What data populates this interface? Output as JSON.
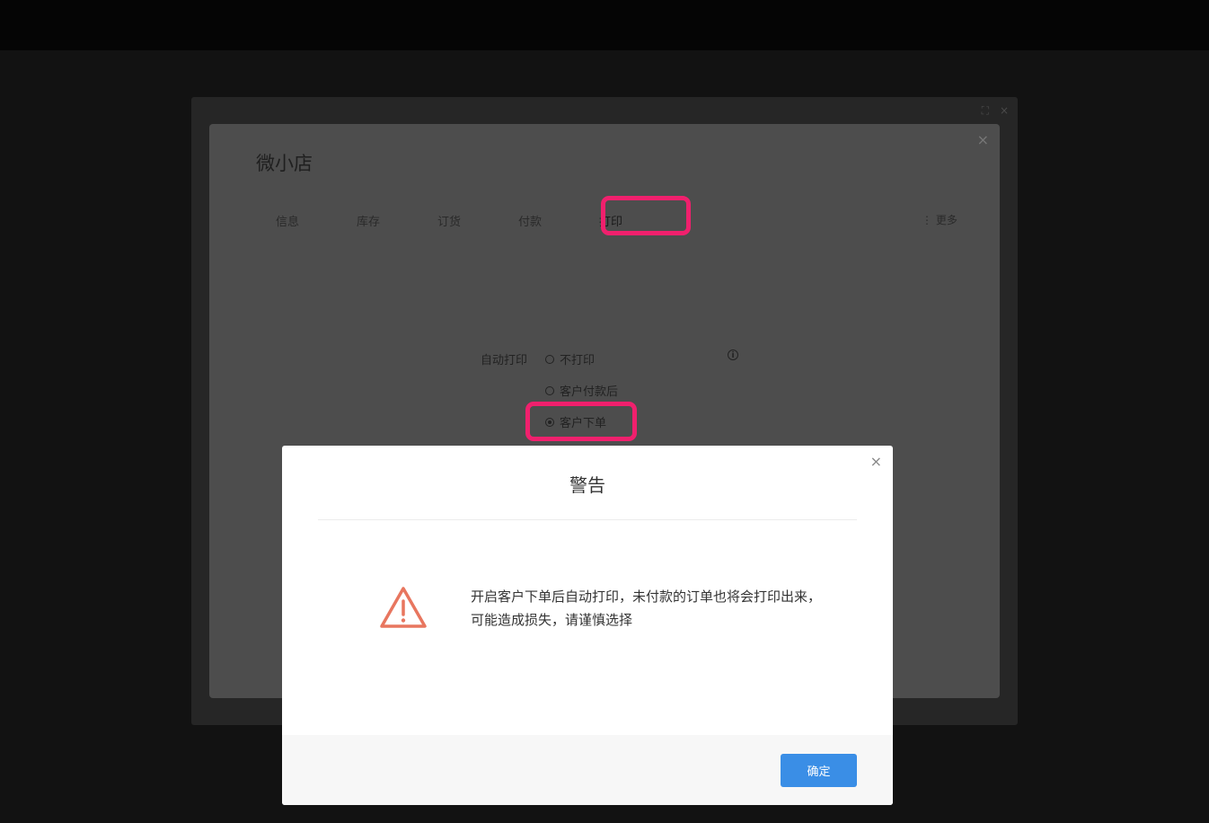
{
  "store_dialog": {
    "title": "微小店",
    "close": "×",
    "tabs": [
      {
        "label": "信息"
      },
      {
        "label": "库存"
      },
      {
        "label": "订货"
      },
      {
        "label": "付款"
      },
      {
        "label": "打印"
      }
    ],
    "active_tab": "打印",
    "more_label": "⋮ 更多",
    "auto_print": {
      "label": "自动打印",
      "options": [
        {
          "label": "不打印",
          "checked": false
        },
        {
          "label": "客户付款后",
          "checked": false
        },
        {
          "label": "客户下单",
          "checked": true
        }
      ],
      "info_icon": "i"
    }
  },
  "warning_modal": {
    "title": "警告",
    "close": "×",
    "icon": "warning-triangle-icon",
    "icon_color": "#e8765f",
    "message": "开启客户下单后自动打印，未付款的订单也将会打印出来，可能造成损失，请谨慎选择",
    "confirm_label": "确定",
    "confirm_color": "#3a8ee6"
  },
  "highlight_color": "#f0206d"
}
